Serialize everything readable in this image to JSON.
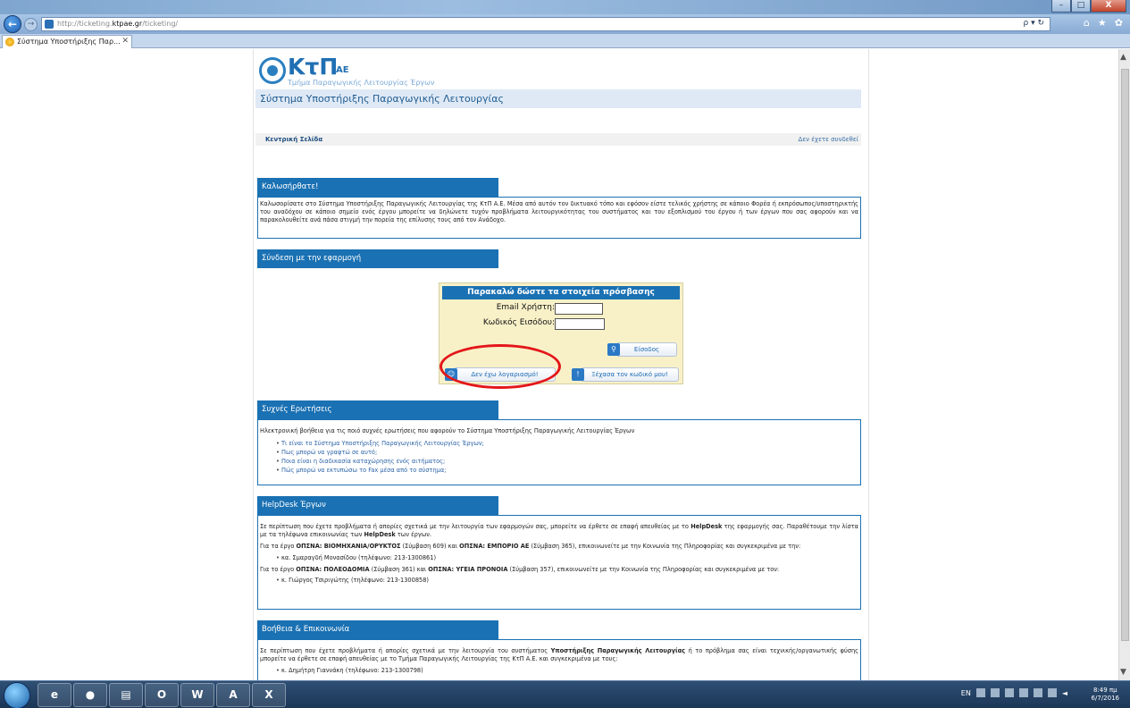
{
  "browser": {
    "url_prefix": "http://ticketing.",
    "url_host": "ktpae.gr",
    "url_path": "/ticketing/",
    "address_tools": "ρ ▾ ↻",
    "tab_title": "Σύστημα Υποστήριξης Παρ...",
    "win_minimize": "–",
    "win_maximize": "□",
    "win_close": "X"
  },
  "header": {
    "logo_text": "ΚτΠ",
    "logo_ae": "ΑΕ",
    "logo_sub": "Τμήμα Παραγωγικής Λειτουργίας Έργων",
    "system_title": "Σύστημα Υποστήριξης Παραγωγικής Λειτουργίας",
    "home_link": "Κεντρική Σελίδα",
    "login_status": "Δεν έχετε συνδεθεί"
  },
  "welcome": {
    "heading": "Καλωσήρθατε!",
    "text": "Καλωσορίσατε στο Σύστημα Υποστήριξης Παραγωγικής Λειτουργίας της ΚτΠ Α.Ε. Μέσα από αυτόν τον δικτυακό τόπο και εφόσον είστε τελικός χρήστης σε κάποιο Φορέα ή εκπρόσωπος/υποστηρικτής του αναδόχου σε κάποιο σημείο ενός έργου μπορείτε να δηλώνετε τυχόν προβλήματα λειτουργικότητας του συστήματος και του εξοπλισμού του έργου ή των έργων που σας αφορούν και να παρακολουθείτε ανά πάσα στιγμή την πορεία της επίλυσης τους από τον Ανάδοχο."
  },
  "login": {
    "heading": "Σύνδεση με την εφαρμογή",
    "box_title": "Παρακαλώ δώστε τα στοιχεία πρόσβασης",
    "email_label": "Email Χρήστη:",
    "email_value": "",
    "password_label": "Κωδικός Εισόδου:",
    "password_value": "",
    "submit_label": "Είσοδος",
    "no_account_label": "Δεν έχω λογαριασμό!",
    "forgot_label": "Ξέχασα τον κωδικό μου!",
    "highlight_color": "#e4161a"
  },
  "faq": {
    "heading": "Συχνές Ερωτήσεις",
    "intro": "Ηλεκτρονική βοήθεια για τις ποιό συχνές ερωτήσεις που αφορούν το Σύστημα Υποστήριξης Παραγωγικής Λειτουργίας Έργων",
    "items": [
      "Τι είναι το Σύστημα Υποστήριξης Παραγωγικής Λειτουργίας Έργων;",
      "Πως μπορώ να γραφτώ σε αυτό;",
      "Ποια είναι η διαδικασία καταχώρησης ενός αιτήματος;",
      "Πώς μπορώ να εκτυπώσω το Fax μέσα από το σύστημα;"
    ]
  },
  "helpdesk": {
    "heading": "HelpDesk Έργων",
    "intro_a": "Σε περίπτωση που έχετε προβλήματα ή απορίες σχετικά με την λειτουργία των εφαρμογών σας, μπορείτε να έρθετε σε επαφή απευθείας με το ",
    "intro_b": "HelpDesk",
    "intro_c": " της εφαρμογής σας. Παραθέτουμε την λίστα με τα τηλέφωνα επικοινωνίας των ",
    "intro_d": "HelpDesk",
    "intro_e": " των έργων.",
    "p1_a": "Για τα έργο ",
    "p1_b": "ΟΠΣΝΑ: ΒΙΟΜΗΧΑΝΙΑ/ΟΡΥΚΤΟΣ",
    "p1_c": " (Σύμβαση 609) και ",
    "p1_d": "ΟΠΣΝΑ: ΕΜΠΟΡΙΟ ΑΕ",
    "p1_e": " (Σύμβαση 365), επικοινωνείτε με την Κοινωνία της Πληροφορίας και συγκεκριμένα με την:",
    "contact1": "κα. Σμαραγδή Μονασίδου (τηλέφωνο: 213-1300861)",
    "p2_a": "Για το έργο ",
    "p2_b": "ΟΠΣΝΑ: ΠΟΛΕΟΔΟΜΙΑ",
    "p2_c": " (Σύμβαση 361) και ",
    "p2_d": "ΟΠΣΝΑ: ΥΓΕΙΑ ΠΡΟΝΟΙΑ",
    "p2_e": " (Σύμβαση 357), επικοινωνείτε με την Κοινωνία της Πληροφορίας και συγκεκριμένα με τον:",
    "contact2": "κ. Γιώργος Τσιριγώτης (τηλέφωνο: 213-1300858)"
  },
  "support": {
    "heading": "Βοήθεια & Επικοινωνία",
    "text_a": "Σε περίπτωση που έχετε προβλήματα ή απορίες σχετικά με την λειτουργία του συστήματος ",
    "text_b": "Υποστήριξης Παραγωγικής Λειτουργίας",
    "text_c": " ή το πρόβλημα σας είναι τεχνικής/οργανωτικής φύσης μπορείτε να έρθετε σε επαφή απευθείας με το Τμήμα Παραγωγικής Λειτουργίας της ΚτΠ Α.Ε. και συγκεκριμένα με τους:",
    "contact1": "κ. Δημήτρη Γιαννάκη (τηλέφωνο: 213-1300798)"
  },
  "taskbar": {
    "lang": "EN",
    "time": "8:49 πμ",
    "date": "6/7/2016",
    "apps": [
      "e",
      "●",
      "▤",
      "O",
      "W",
      "A",
      "X"
    ]
  },
  "colors": {
    "brand_blue": "#1a71b3",
    "login_bg": "#f8f1c8"
  }
}
